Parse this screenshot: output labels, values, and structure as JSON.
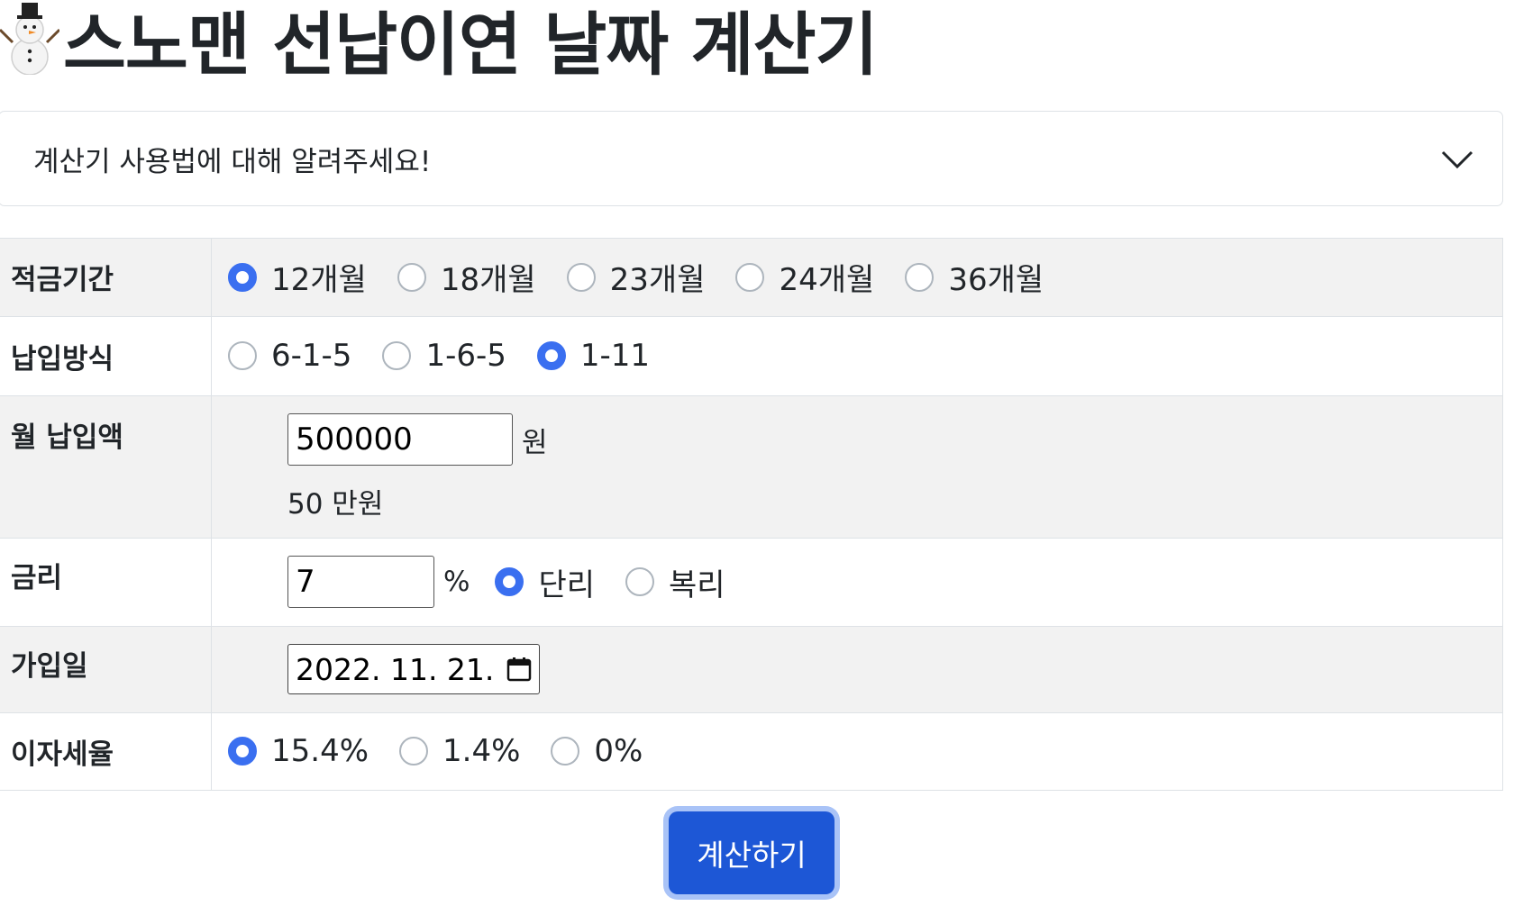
{
  "title": "스노맨 선납이연 날짜 계산기",
  "title_icon": "snowman-icon",
  "accordion": {
    "label": "계산기 사용법에 대해 알려주세요!",
    "icon": "chevron-down-icon"
  },
  "rows": {
    "period": {
      "label": "적금기간",
      "options": [
        "12개월",
        "18개월",
        "23개월",
        "24개월",
        "36개월"
      ],
      "selected": "12개월"
    },
    "method": {
      "label": "납입방식",
      "options": [
        "6-1-5",
        "1-6-5",
        "1-11"
      ],
      "selected": "1-11"
    },
    "monthly": {
      "label": "월 납입액",
      "value": "500000",
      "unit": "원",
      "hint": "50 만원"
    },
    "rate": {
      "label": "금리",
      "value": "7",
      "unit": "%",
      "options": [
        "단리",
        "복리"
      ],
      "selected": "단리"
    },
    "join_date": {
      "label": "가입일",
      "value": "2022. 11. 21.",
      "icon": "calendar-icon"
    },
    "tax": {
      "label": "이자세율",
      "options": [
        "15.4%",
        "1.4%",
        "0%"
      ],
      "selected": "15.4%"
    }
  },
  "submit_label": "계산하기",
  "colors": {
    "accent": "#3a6ff0",
    "button": "#1d57d6",
    "row_shade": "#f2f2f2"
  }
}
